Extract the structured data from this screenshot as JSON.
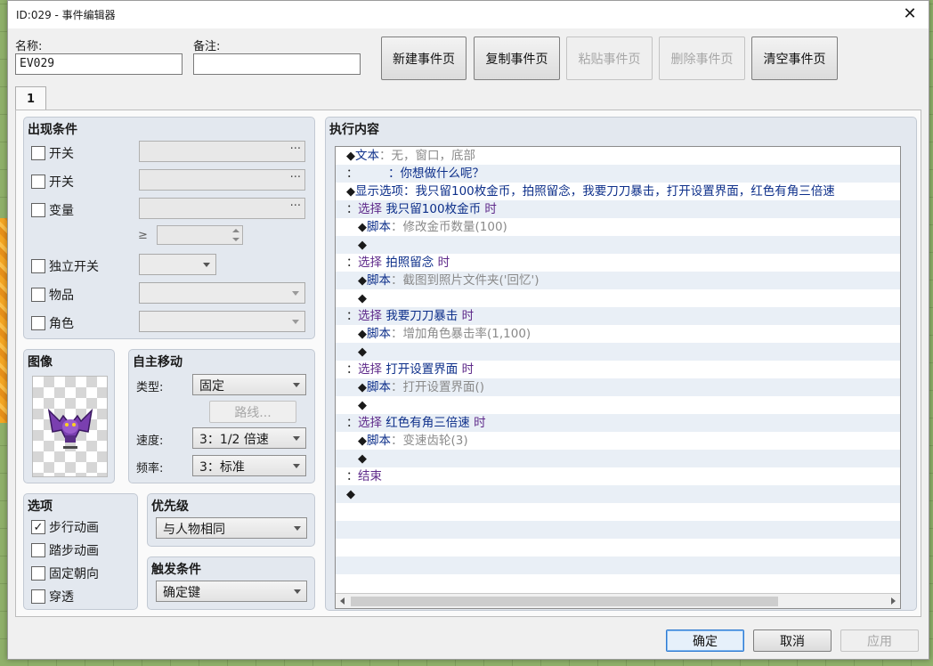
{
  "window": {
    "title": "ID:029 - 事件编辑器"
  },
  "name": {
    "label": "名称:",
    "value": "EV029"
  },
  "note": {
    "label": "备注:",
    "value": ""
  },
  "toolbar": {
    "new_page": "新建事件页",
    "copy_page": "复制事件页",
    "paste_page": "粘贴事件页",
    "delete_page": "删除事件页",
    "clear_page": "清空事件页"
  },
  "tab": {
    "label": "1"
  },
  "conditions": {
    "title": "出现条件",
    "switch1": "开关",
    "switch2": "开关",
    "variable": "变量",
    "ge": "≥",
    "self_switch": "独立开关",
    "item": "物品",
    "actor": "角色"
  },
  "image": {
    "title": "图像"
  },
  "autonomous": {
    "title": "自主移动",
    "type_label": "类型:",
    "type_value": "固定",
    "route_button": "路线...",
    "speed_label": "速度:",
    "speed_value": "3：1/2 倍速",
    "freq_label": "频率:",
    "freq_value": "3：标准"
  },
  "options": {
    "title": "选项",
    "walking_anim": "步行动画",
    "stepping_anim": "踏步动画",
    "direction_fix": "固定朝向",
    "through": "穿透",
    "walking_checked": true,
    "check_mark": "✓"
  },
  "priority": {
    "title": "优先级",
    "value": "与人物相同"
  },
  "trigger": {
    "title": "触发条件",
    "value": "确定键"
  },
  "contents": {
    "title": "执行内容",
    "rows": [
      {
        "a": "◆",
        "b": "文本",
        "c": "：无，窗口，底部",
        "d": ""
      },
      {
        "a": "：",
        "b": "",
        "c": "　　　：你想做什么呢？",
        "d": ""
      },
      {
        "a": "◆",
        "b": "显示选项",
        "c": "：我只留100枚金币，拍照留念，我要刀刀暴击，打开设置界面，红色有角三倍速",
        "d": ""
      },
      {
        "a": "：",
        "b": "选择",
        "c": " 我只留100枚金币",
        "d": " 时"
      },
      {
        "a": "　◆",
        "b": "脚本",
        "c": "：修改金币数量(100)",
        "d": ""
      },
      {
        "a": "　◆",
        "b": "",
        "c": "",
        "d": ""
      },
      {
        "a": "：",
        "b": "选择",
        "c": " 拍照留念",
        "d": " 时"
      },
      {
        "a": "　◆",
        "b": "脚本",
        "c": "：截图到照片文件夹('回忆')",
        "d": ""
      },
      {
        "a": "　◆",
        "b": "",
        "c": "",
        "d": ""
      },
      {
        "a": "：",
        "b": "选择",
        "c": " 我要刀刀暴击",
        "d": " 时"
      },
      {
        "a": "　◆",
        "b": "脚本",
        "c": "：增加角色暴击率(1,100)",
        "d": ""
      },
      {
        "a": "　◆",
        "b": "",
        "c": "",
        "d": ""
      },
      {
        "a": "：",
        "b": "选择",
        "c": " 打开设置界面",
        "d": " 时"
      },
      {
        "a": "　◆",
        "b": "脚本",
        "c": "：打开设置界面()",
        "d": ""
      },
      {
        "a": "　◆",
        "b": "",
        "c": "",
        "d": ""
      },
      {
        "a": "：",
        "b": "选择",
        "c": " 红色有角三倍速",
        "d": " 时"
      },
      {
        "a": "　◆",
        "b": "脚本",
        "c": "：变速齿轮(3)",
        "d": ""
      },
      {
        "a": "　◆",
        "b": "",
        "c": "",
        "d": ""
      },
      {
        "a": "：",
        "b": "结束",
        "c": "",
        "d": ""
      },
      {
        "a": "◆",
        "b": "",
        "c": "",
        "d": ""
      }
    ]
  },
  "footer": {
    "ok": "确定",
    "cancel": "取消",
    "apply": "应用"
  }
}
